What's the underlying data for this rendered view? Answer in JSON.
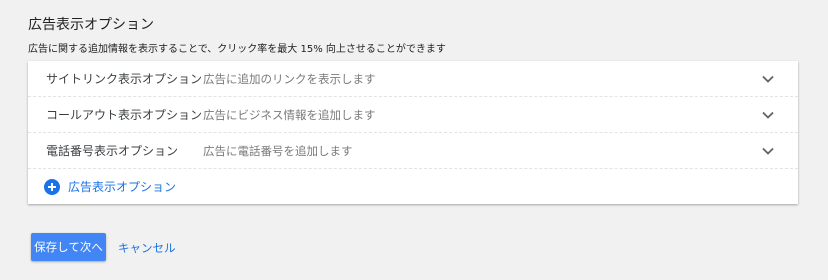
{
  "section": {
    "title": "広告表示オプション",
    "description": "広告に関する追加情報を表示することで、クリック率を最大 15% 向上させることができます"
  },
  "options": [
    {
      "label": "サイトリンク表示オプション",
      "description": "広告に追加のリンクを表示します",
      "icon": "chevron-down-icon"
    },
    {
      "label": "コールアウト表示オプション",
      "description": "広告にビジネス情報を追加します",
      "icon": "chevron-down-icon"
    },
    {
      "label": "電話番号表示オプション",
      "description": "広告に電話番号を追加します",
      "icon": "chevron-down-icon"
    }
  ],
  "add_option": {
    "label": "広告表示オプション",
    "icon": "add-circle-icon",
    "color": "#1a73e8"
  },
  "actions": {
    "save_label": "保存して次へ",
    "cancel_label": "キャンセル",
    "primary_color": "#4285f4"
  }
}
